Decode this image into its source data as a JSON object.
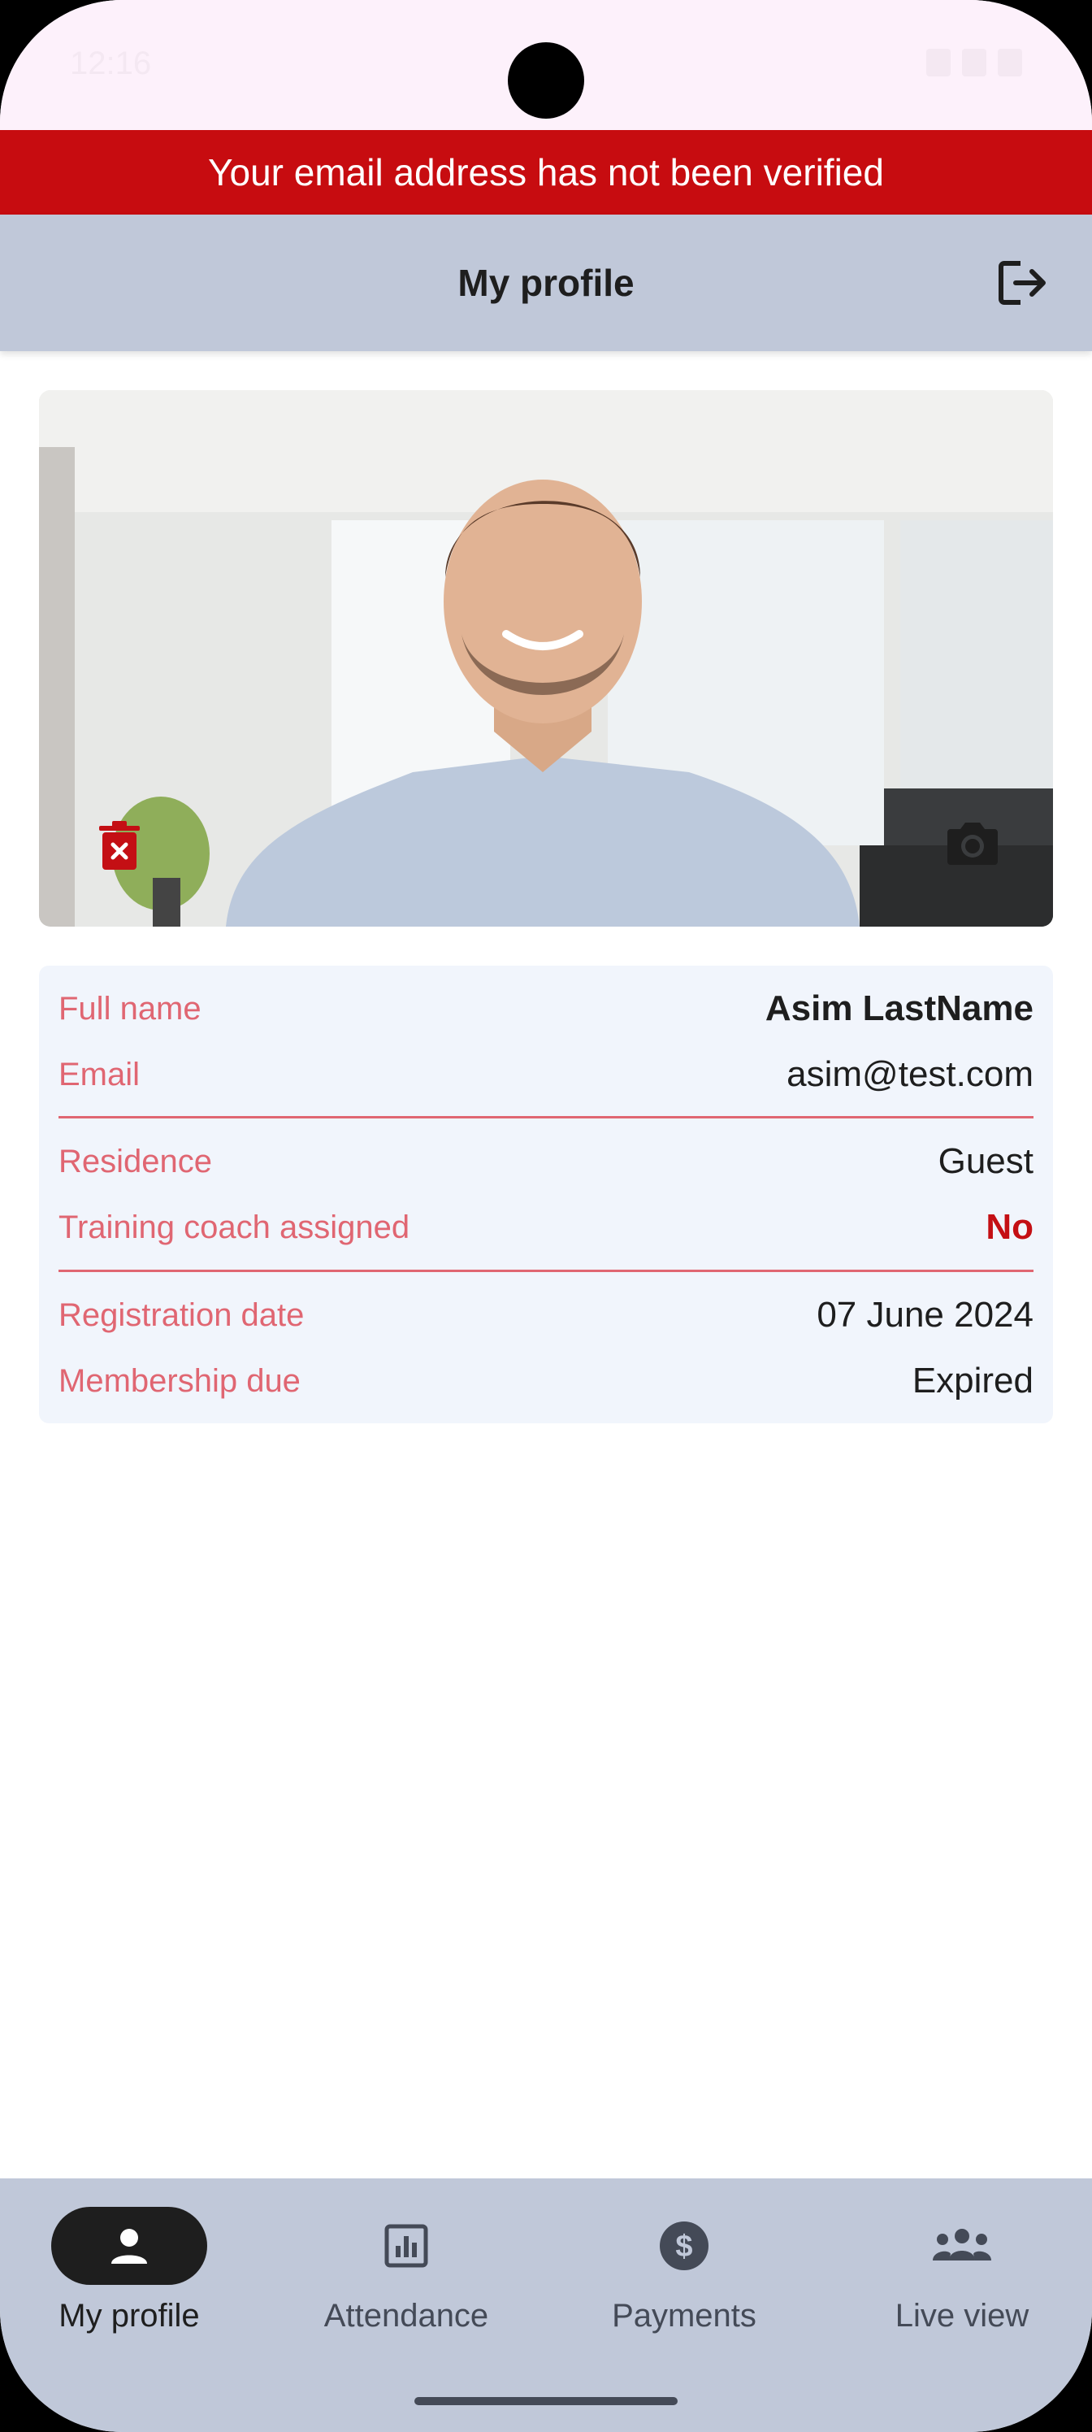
{
  "status_bar": {
    "time": "12:16"
  },
  "banner": {
    "text": "Your email address has not been verified"
  },
  "app_bar": {
    "title": "My profile",
    "logout_icon": "logout-icon"
  },
  "photo": {
    "delete_icon": "delete-photo-icon",
    "camera_icon": "camera-icon",
    "accent": "#c40f14"
  },
  "profile": {
    "groups": [
      [
        {
          "label": "Full name",
          "value": "Asim LastName",
          "style": "bold"
        },
        {
          "label": "Email",
          "value": "asim@test.com",
          "style": "normal"
        }
      ],
      [
        {
          "label": "Residence",
          "value": "Guest",
          "style": "normal"
        },
        {
          "label": "Training coach assigned",
          "value": "No",
          "style": "red"
        }
      ],
      [
        {
          "label": "Registration date",
          "value": "07 June 2024",
          "style": "normal"
        },
        {
          "label": "Membership due",
          "value": "Expired",
          "style": "normal"
        }
      ]
    ]
  },
  "bottom_nav": {
    "items": [
      {
        "label": "My profile",
        "icon": "person-icon",
        "active": true
      },
      {
        "label": "Attendance",
        "icon": "chart-icon",
        "active": false
      },
      {
        "label": "Payments",
        "icon": "dollar-icon",
        "active": false
      },
      {
        "label": "Live view",
        "icon": "group-icon",
        "active": false
      }
    ]
  },
  "colors": {
    "banner": "#c70c10",
    "app_bar": "#c0c8d9",
    "label": "#e06672",
    "card": "#f1f5fc"
  }
}
